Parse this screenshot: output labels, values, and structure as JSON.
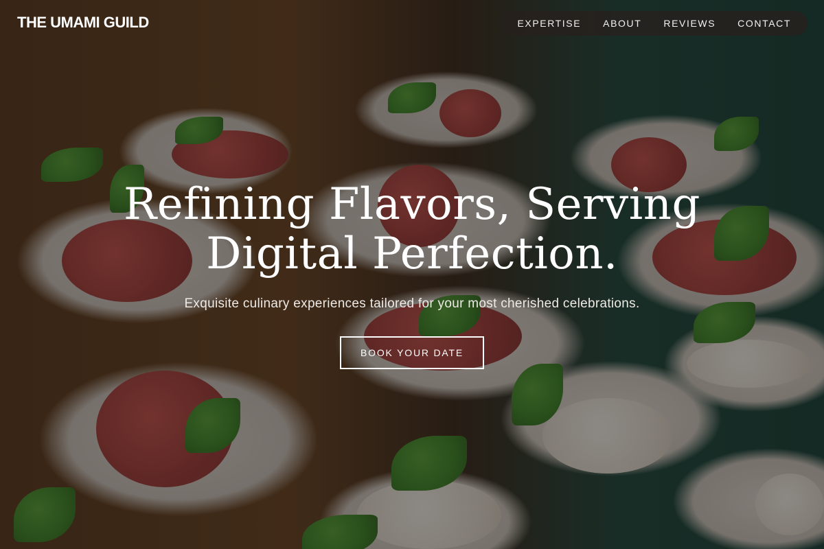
{
  "brand": {
    "name": "THE UMAMI GUILD"
  },
  "nav": {
    "items": [
      {
        "label": "EXPERTISE"
      },
      {
        "label": "ABOUT"
      },
      {
        "label": "REVIEWS"
      },
      {
        "label": "CONTACT"
      }
    ]
  },
  "hero": {
    "headline_line1": "Refining Flavors, Serving",
    "headline_line2": "Digital Perfection.",
    "subheadline": "Exquisite culinary experiences tailored for your most cherished celebrations.",
    "cta_label": "BOOK YOUR DATE",
    "background_image": "plated-appetizers-prosciutto-and-mozzarella"
  }
}
